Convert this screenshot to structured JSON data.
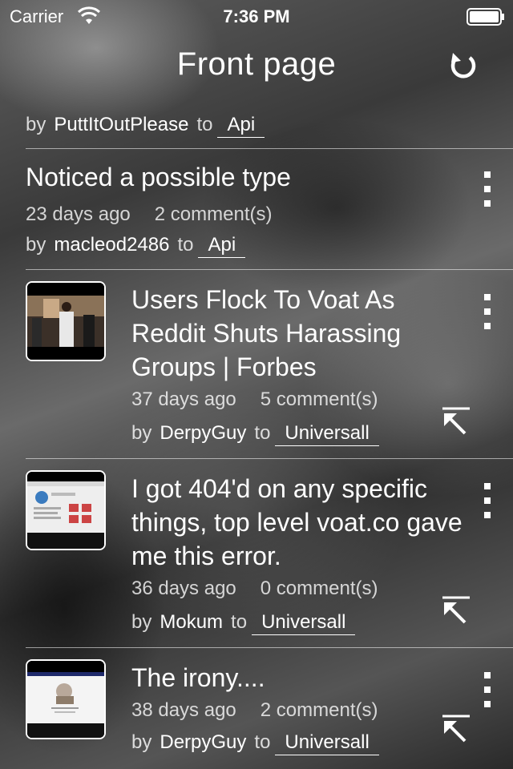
{
  "status_bar": {
    "carrier": "Carrier",
    "time": "7:36 PM"
  },
  "nav": {
    "title": "Front page",
    "refresh_icon": "refresh-icon"
  },
  "colors": {
    "text": "#ffffff",
    "divider": "#bfbfbf"
  },
  "posts": [
    {
      "author": "PuttItOutPlease",
      "by": "by",
      "to": "to",
      "subverse": "Api"
    },
    {
      "title": "Noticed a possible type",
      "age": "23 days ago",
      "comments": "2 comment(s)",
      "by": "by",
      "author": "macleod2486",
      "to": "to",
      "subverse": "Api"
    },
    {
      "title": "Users Flock To Voat As Reddit Shuts Harassing Groups | Forbes",
      "age": "37 days ago",
      "comments": "5 comment(s)",
      "by": "by",
      "author": "DerpyGuy",
      "to": "to",
      "subverse": "Universall"
    },
    {
      "title": "I got 404'd on any specific things, top level voat.co gave me this error.",
      "age": "36 days ago",
      "comments": "0 comment(s)",
      "by": "by",
      "author": "Mokum",
      "to": "to",
      "subverse": "Universall"
    },
    {
      "title": "The irony....",
      "age": "38 days ago",
      "comments": "2 comment(s)",
      "by": "by",
      "author": "DerpyGuy",
      "to": "to",
      "subverse": "Universall"
    }
  ]
}
